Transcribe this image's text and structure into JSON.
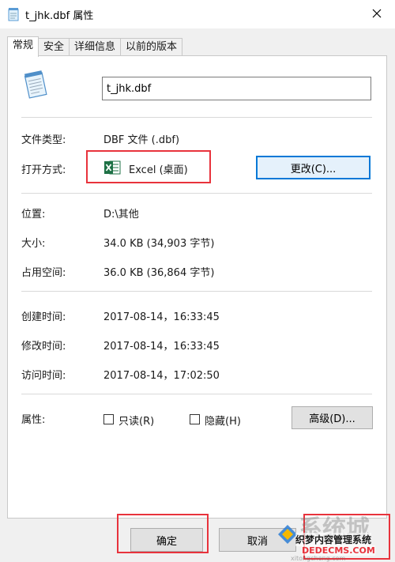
{
  "window": {
    "title": "t_jhk.dbf 属性",
    "close_icon": "close-icon"
  },
  "tabs": [
    {
      "label": "常规",
      "active": true
    },
    {
      "label": "安全",
      "active": false
    },
    {
      "label": "详细信息",
      "active": false
    },
    {
      "label": "以前的版本",
      "active": false
    }
  ],
  "file": {
    "name": "t_jhk.dbf",
    "icon": "notepad-file-icon"
  },
  "type": {
    "label": "文件类型:",
    "value": "DBF 文件 (.dbf)"
  },
  "opens_with": {
    "label": "打开方式:",
    "app": "Excel (桌面)",
    "app_icon": "excel-icon",
    "change_button": "更改(C)..."
  },
  "location": {
    "label": "位置:",
    "value": "D:\\其他"
  },
  "size": {
    "label": "大小:",
    "value": "34.0 KB (34,903 字节)"
  },
  "size_on_disk": {
    "label": "占用空间:",
    "value": "36.0 KB (36,864 字节)"
  },
  "created": {
    "label": "创建时间:",
    "value": "2017-08-14，16:33:45"
  },
  "modified": {
    "label": "修改时间:",
    "value": "2017-08-14，16:33:45"
  },
  "accessed": {
    "label": "访问时间:",
    "value": "2017-08-14，17:02:50"
  },
  "attributes": {
    "label": "属性:",
    "readonly": {
      "label": "只读(R)",
      "checked": false
    },
    "hidden": {
      "label": "隐藏(H)",
      "checked": false
    },
    "advanced_button": "高级(D)..."
  },
  "footer": {
    "ok": "确定",
    "cancel": "取消"
  },
  "highlight_color": "#e8333c",
  "watermark": {
    "logo_text": "系统城",
    "line1": "织梦内容管理系统",
    "line2": "DEDECMS.COM",
    "line3": "xitongcheng.com"
  }
}
